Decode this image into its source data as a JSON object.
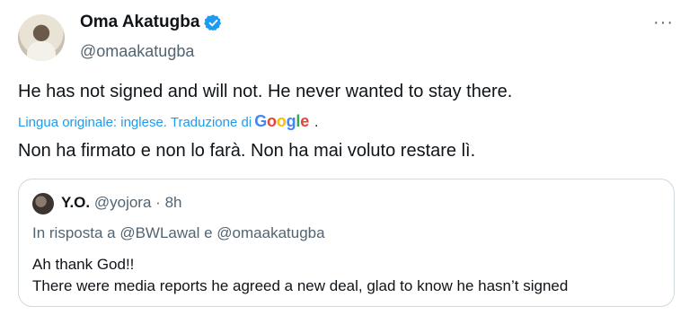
{
  "tweet": {
    "author_name": "Oma Akatugba",
    "author_handle": "@omaakatugba",
    "more_icon": "···",
    "text": "He has not signed and will not. He never wanted to stay there.",
    "translation_label": "Lingua originale: inglese. Traduzione di",
    "google_letters": [
      "G",
      "o",
      "o",
      "g",
      "l",
      "e"
    ],
    "translation_dot": ".",
    "translated_text": "Non ha firmato e non lo farà. Non ha mai voluto restare lì.",
    "verified_color": "#1d9bf0"
  },
  "quoted_tweet": {
    "author_name": "Y.O.",
    "author_handle": "@yojora",
    "separator": "·",
    "time": "8h",
    "reply_context": "In risposta a @BWLawal e @omaakatugba",
    "line1": "Ah thank God!!",
    "line2": "There were media reports he agreed a new deal, glad to know he hasn’t signed"
  }
}
